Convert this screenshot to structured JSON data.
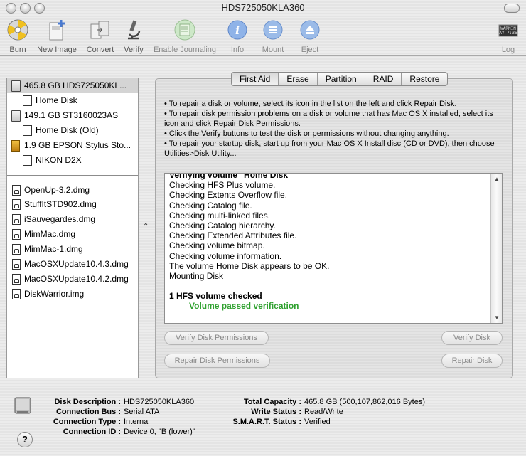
{
  "window": {
    "title": "HDS725050KLA360"
  },
  "toolbar": {
    "burn": "Burn",
    "new_image": "New Image",
    "convert": "Convert",
    "verify": "Verify",
    "enable_journaling": "Enable Journaling",
    "info": "Info",
    "mount": "Mount",
    "eject": "Eject",
    "log": "Log",
    "log_icon_text": "WARNIN\nAY 7:36"
  },
  "sidebar": {
    "disks": [
      {
        "label": "465.8 GB HDS725050KL...",
        "kind": "disk",
        "selected": true
      },
      {
        "label": "Home Disk",
        "kind": "volume"
      },
      {
        "label": "149.1 GB ST3160023AS",
        "kind": "disk"
      },
      {
        "label": "Home Disk (Old)",
        "kind": "volume"
      },
      {
        "label": "1.9 GB EPSON Stylus Sto...",
        "kind": "usb"
      },
      {
        "label": "NIKON D2X",
        "kind": "volume"
      }
    ],
    "images": [
      {
        "label": "OpenUp-3.2.dmg"
      },
      {
        "label": "StuffItSTD902.dmg"
      },
      {
        "label": "iSauvegardes.dmg"
      },
      {
        "label": "MimMac.dmg"
      },
      {
        "label": "MimMac-1.dmg"
      },
      {
        "label": "MacOSXUpdate10.4.3.dmg"
      },
      {
        "label": "MacOSXUpdate10.4.2.dmg"
      },
      {
        "label": "DiskWarrior.img"
      }
    ]
  },
  "tabs": [
    "First Aid",
    "Erase",
    "Partition",
    "RAID",
    "Restore"
  ],
  "first_aid": {
    "instructions": [
      "• To repair a disk or volume, select its icon in the list on the left and click Repair Disk.",
      "• To repair disk permission problems on a disk or volume that has Mac OS X installed, select its icon and click Repair Disk Permissions.",
      "• Click the Verify buttons to test the disk or permissions without changing anything.",
      "• To repair your startup disk, start up from your Mac OS X Install disc (CD or DVD), then choose Utilities>Disk Utility..."
    ],
    "log": [
      "Verifying volume \"Home Disk\"",
      "Checking HFS Plus volume.",
      "Checking Extents Overflow file.",
      "Checking Catalog file.",
      "Checking multi-linked files.",
      "Checking Catalog hierarchy.",
      "Checking Extended Attributes file.",
      "Checking volume bitmap.",
      "Checking volume information.",
      "The volume Home Disk appears to be OK.",
      "Mounting Disk"
    ],
    "summary": "1 HFS volume checked",
    "result": "Volume passed verification",
    "buttons": {
      "verify_permissions": "Verify Disk Permissions",
      "verify_disk": "Verify Disk",
      "repair_permissions": "Repair Disk Permissions",
      "repair_disk": "Repair Disk"
    }
  },
  "info": {
    "left": [
      {
        "key": "Disk Description :",
        "value": "HDS725050KLA360"
      },
      {
        "key": "Connection Bus :",
        "value": "Serial ATA"
      },
      {
        "key": "Connection Type :",
        "value": "Internal"
      },
      {
        "key": "Connection ID :",
        "value": "Device 0, \"B (lower)\""
      }
    ],
    "right": [
      {
        "key": "Total Capacity :",
        "value": "465.8 GB (500,107,862,016 Bytes)"
      },
      {
        "key": "Write Status :",
        "value": "Read/Write"
      },
      {
        "key": "S.M.A.R.T. Status :",
        "value": "Verified"
      }
    ]
  }
}
